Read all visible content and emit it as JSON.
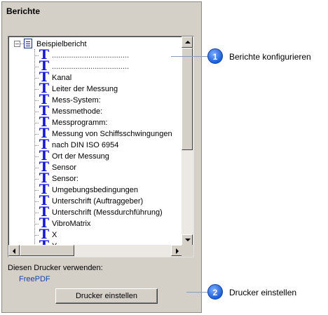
{
  "panel": {
    "title": "Berichte",
    "tree": {
      "root_label": "Beispielbericht",
      "items": [
        {
          "label": "....................................",
          "kind": "dots"
        },
        {
          "label": "....................................",
          "kind": "dots"
        },
        {
          "label": "Kanal"
        },
        {
          "label": "Leiter der Messung"
        },
        {
          "label": "Mess-System:"
        },
        {
          "label": "Messmethode:"
        },
        {
          "label": "Messprogramm:"
        },
        {
          "label": "Messung von Schiffsschwingungen"
        },
        {
          "label": "nach DIN ISO 6954"
        },
        {
          "label": "Ort der Messung"
        },
        {
          "label": "Sensor"
        },
        {
          "label": "Sensor:"
        },
        {
          "label": "Umgebungsbedingungen"
        },
        {
          "label": "Unterschrift (Auftraggeber)"
        },
        {
          "label": "Unterschrift (Messdurchführung)"
        },
        {
          "label": "VibroMatrix"
        },
        {
          "label": "X"
        },
        {
          "label": "Y"
        }
      ]
    },
    "printer_label": "Diesen Drucker verwenden:",
    "printer_name": "FreePDF",
    "setup_button": "Drucker einstellen"
  },
  "callouts": [
    {
      "number": "1",
      "text": "Berichte konfigurieren"
    },
    {
      "number": "2",
      "text": "Drucker einstellen"
    }
  ],
  "colors": {
    "panel_bg": "#d4d0c8",
    "icon_blue": "#1515d8",
    "printer_name": "#1c3fb0",
    "badge": "#1e5cd8"
  },
  "icons": {
    "root": "report-document-icon",
    "item": "text-field-t-icon",
    "expander": "tree-collapse-minus-icon"
  }
}
